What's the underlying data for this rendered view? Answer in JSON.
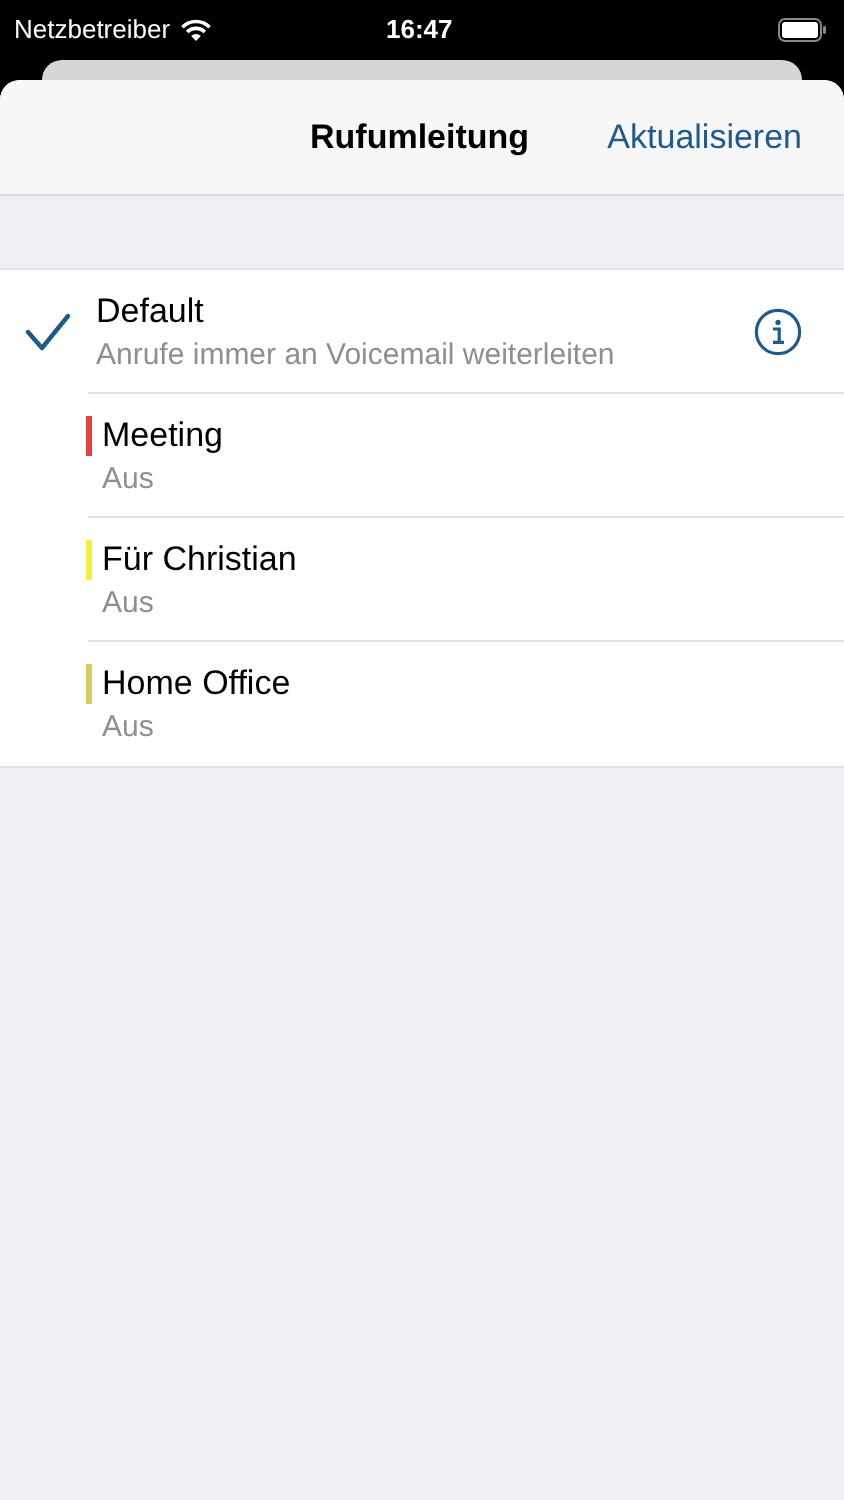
{
  "status_bar": {
    "carrier": "Netzbetreiber",
    "time": "16:47"
  },
  "nav": {
    "title": "Rufumleitung",
    "action": "Aktualisieren"
  },
  "items": [
    {
      "title": "Default",
      "subtitle": "Anrufe immer an Voicemail weiterleiten",
      "selected": true,
      "info_button": true
    },
    {
      "title": "Meeting",
      "subtitle": "Aus",
      "selected": false,
      "info_button": false,
      "color": "#e5413f"
    },
    {
      "title": "Für Christian",
      "subtitle": "Aus",
      "selected": false,
      "info_button": false,
      "color": "#f5f03c"
    },
    {
      "title": "Home Office",
      "subtitle": "Aus",
      "selected": false,
      "info_button": false,
      "color": "#d2cf5a"
    }
  ]
}
